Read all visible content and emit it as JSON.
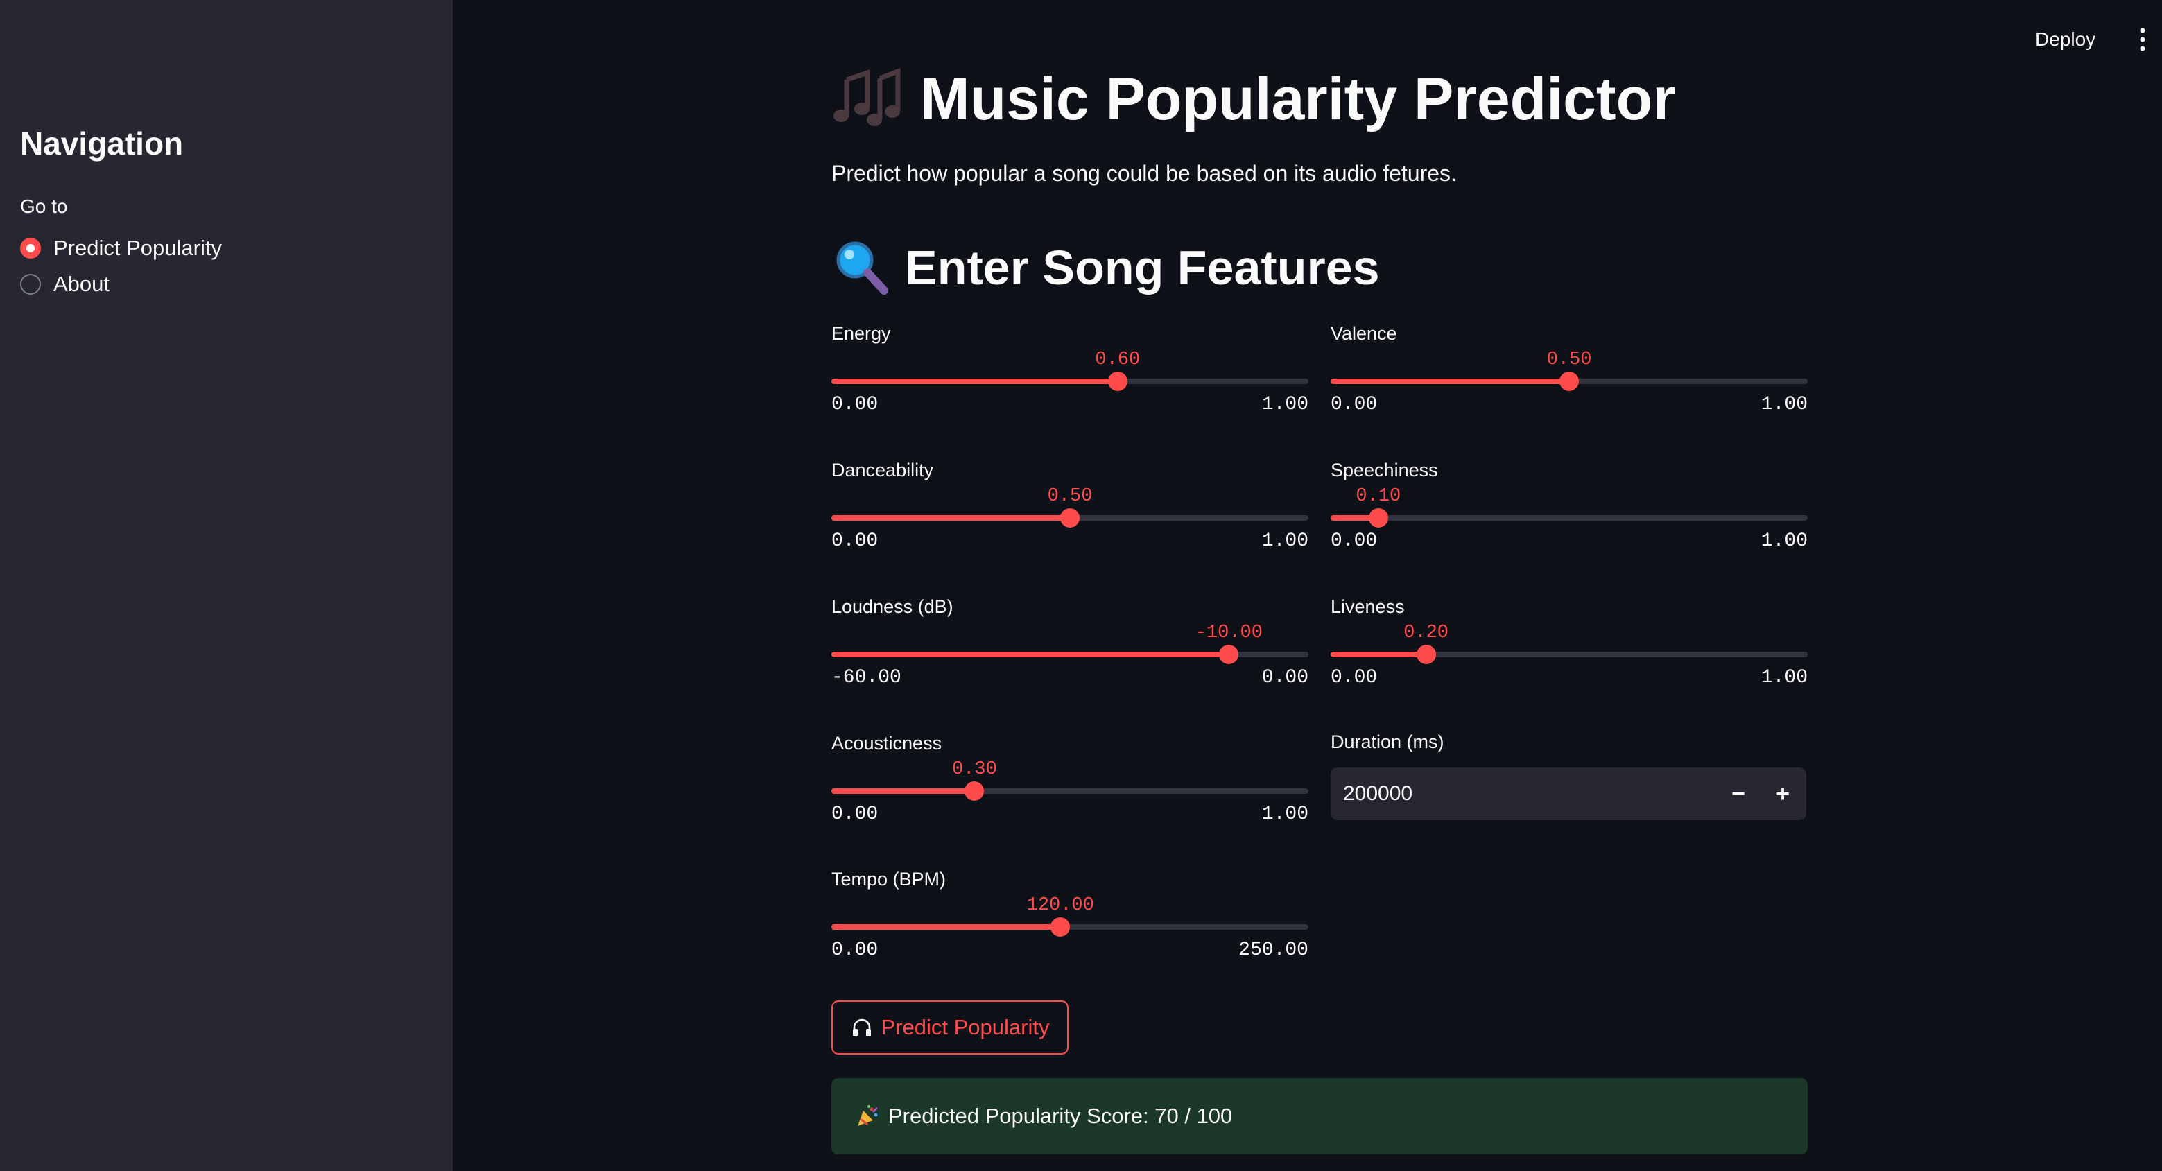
{
  "sidebar": {
    "title": "Navigation",
    "go_to_label": "Go to",
    "options": [
      {
        "label": "Predict Popularity",
        "selected": true
      },
      {
        "label": "About",
        "selected": false
      }
    ]
  },
  "header": {
    "deploy_label": "Deploy",
    "menu_icon": "vertical-dots-icon"
  },
  "main": {
    "title_icon": "musical-notes-icon",
    "title": "Music Popularity Predictor",
    "subtitle": "Predict how popular a song could be based on its audio fetures.",
    "section_icon": "magnifying-glass-icon",
    "section_title": "Enter Song Features",
    "sliders": {
      "energy": {
        "label": "Energy",
        "value": 0.6,
        "value_text": "0.60",
        "min": 0,
        "max": 1,
        "min_text": "0.00",
        "max_text": "1.00"
      },
      "valence": {
        "label": "Valence",
        "value": 0.5,
        "value_text": "0.50",
        "min": 0,
        "max": 1,
        "min_text": "0.00",
        "max_text": "1.00"
      },
      "danceability": {
        "label": "Danceability",
        "value": 0.5,
        "value_text": "0.50",
        "min": 0,
        "max": 1,
        "min_text": "0.00",
        "max_text": "1.00"
      },
      "speechiness": {
        "label": "Speechiness",
        "value": 0.1,
        "value_text": "0.10",
        "min": 0,
        "max": 1,
        "min_text": "0.00",
        "max_text": "1.00"
      },
      "loudness": {
        "label": "Loudness (dB)",
        "value": -10,
        "value_text": "-10.00",
        "min": -60,
        "max": 0,
        "min_text": "-60.00",
        "max_text": "0.00"
      },
      "liveness": {
        "label": "Liveness",
        "value": 0.2,
        "value_text": "0.20",
        "min": 0,
        "max": 1,
        "min_text": "0.00",
        "max_text": "1.00"
      },
      "acousticness": {
        "label": "Acousticness",
        "value": 0.3,
        "value_text": "0.30",
        "min": 0,
        "max": 1,
        "min_text": "0.00",
        "max_text": "1.00"
      },
      "tempo": {
        "label": "Tempo (BPM)",
        "value": 120,
        "value_text": "120.00",
        "min": 0,
        "max": 250,
        "min_text": "0.00",
        "max_text": "250.00"
      }
    },
    "duration": {
      "label": "Duration (ms)",
      "value": "200000",
      "decrement_label": "−",
      "increment_label": "+"
    },
    "predict_button": {
      "icon": "headphones-icon",
      "label": "Predict Popularity"
    },
    "result": {
      "icon": "party-popper-icon",
      "text": "Predicted Popularity Score: 70 / 100"
    }
  },
  "colors": {
    "accent": "#ff4b4b",
    "background": "#0e1117",
    "sidebar": "#262730",
    "success_bg": "#1c3829"
  }
}
